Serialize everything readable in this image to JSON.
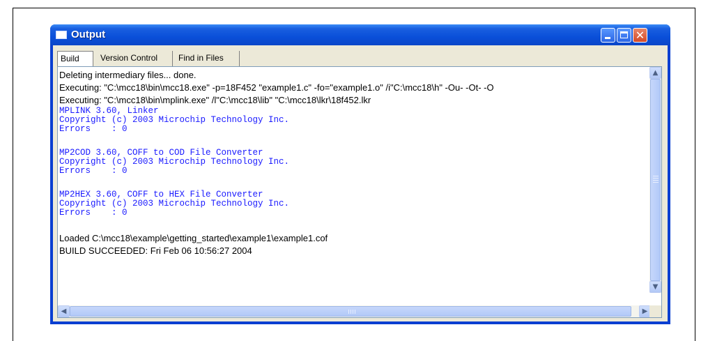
{
  "window": {
    "title": "Output"
  },
  "tabs": [
    {
      "label": "Build",
      "active": true
    },
    {
      "label": "Version Control",
      "active": false
    },
    {
      "label": "Find in Files",
      "active": false
    }
  ],
  "output": {
    "line_1": "Deleting intermediary files... done.",
    "line_2": "Executing: \"C:\\mcc18\\bin\\mcc18.exe\" -p=18F452 \"example1.c\" -fo=\"example1.o\" /i\"C:\\mcc18\\h\" -Ou- -Ot- -O",
    "line_3": "Executing: \"C:\\mcc18\\bin\\mplink.exe\" /l\"C:\\mcc18\\lib\" \"C:\\mcc18\\lkr\\18f452.lkr",
    "line_4": "MPLINK 3.60, Linker",
    "line_5": "Copyright (c) 2003 Microchip Technology Inc.",
    "line_6": "Errors    : 0",
    "line_7": "MP2COD 3.60, COFF to COD File Converter",
    "line_8": "Copyright (c) 2003 Microchip Technology Inc.",
    "line_9": "Errors    : 0",
    "line_10": "MP2HEX 3.60, COFF to HEX File Converter",
    "line_11": "Copyright (c) 2003 Microchip Technology Inc.",
    "line_12": "Errors    : 0",
    "line_13": "Loaded C:\\mcc18\\example\\getting_started\\example1\\example1.cof",
    "line_14": "BUILD SUCCEEDED: Fri Feb 06 10:56:27 2004"
  },
  "colors": {
    "tool_output_text": "#1a1aff",
    "titlebar": "#0a4fd9",
    "close_button": "#d54a27"
  },
  "icons": {
    "title": "window-icon",
    "minimize": "minimize-icon",
    "maximize": "maximize-icon",
    "close": "close-icon",
    "scroll_up": "arrow-up-icon",
    "scroll_down": "arrow-down-icon",
    "scroll_left": "arrow-left-icon",
    "scroll_right": "arrow-right-icon"
  }
}
